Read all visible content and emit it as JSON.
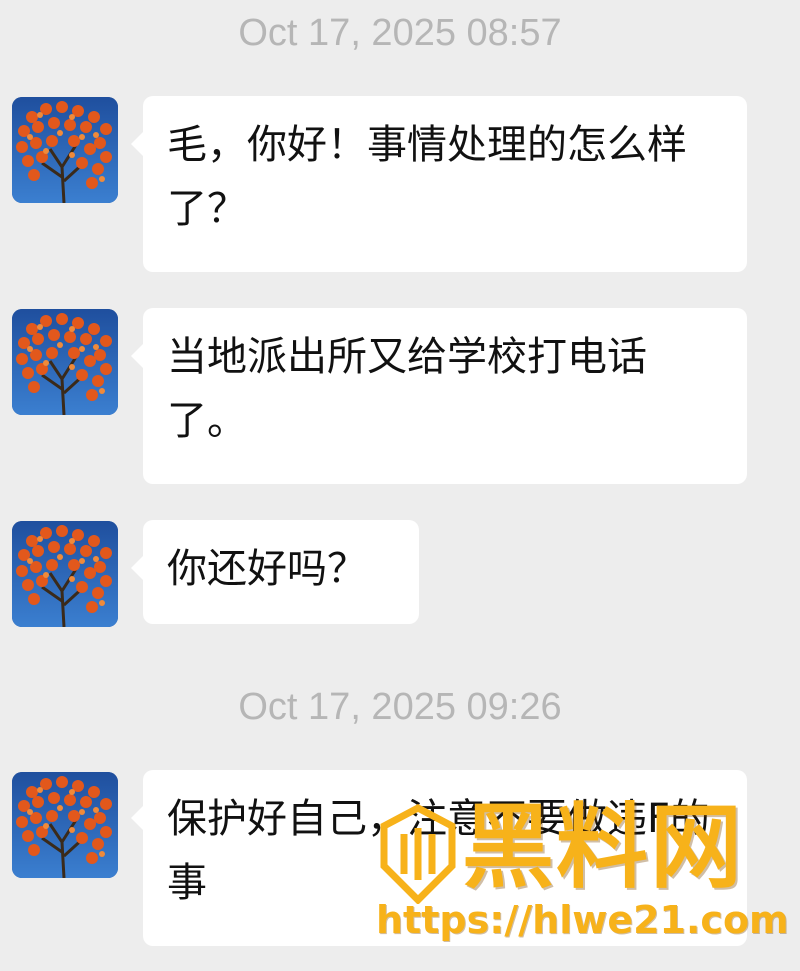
{
  "colors": {
    "background": "#ededed",
    "bubble": "#ffffff",
    "timestamp": "#b6b6b6",
    "text": "#111111",
    "watermark": "#f7b21a"
  },
  "messages_group_1": {
    "timestamp": "Oct 17, 2025 08:57",
    "messages": [
      {
        "avatar_icon": "persimmon-tree-avatar",
        "text": "毛，你好！事情处理的怎么样了？"
      },
      {
        "avatar_icon": "persimmon-tree-avatar",
        "text": "当地派出所又给学校打电话了。"
      },
      {
        "avatar_icon": "persimmon-tree-avatar",
        "text": "你还好吗？"
      }
    ]
  },
  "messages_group_2": {
    "timestamp": "Oct 17, 2025 09:26",
    "messages": [
      {
        "avatar_icon": "persimmon-tree-avatar",
        "text": "保护好自己，注意不要做违F的事"
      }
    ]
  },
  "watermark": {
    "title": "黑料网",
    "url": "https://hlwe21.com"
  }
}
